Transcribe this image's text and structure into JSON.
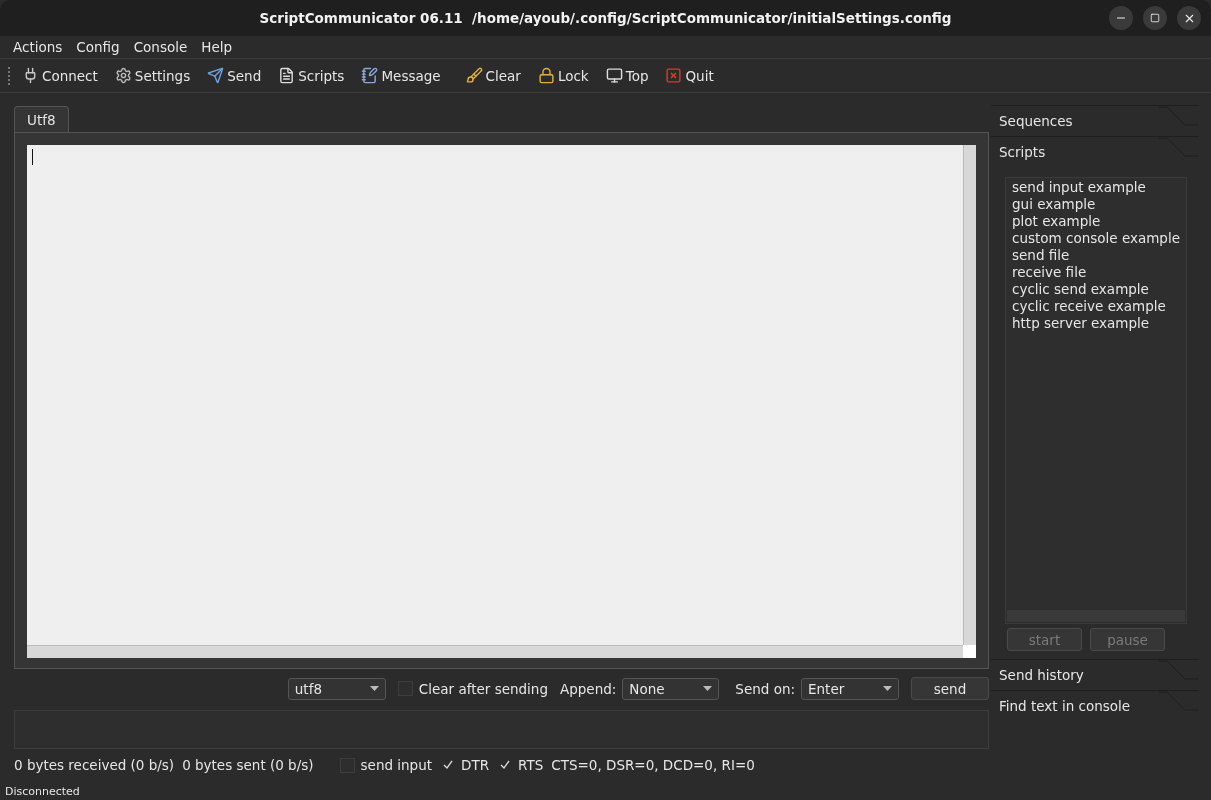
{
  "window": {
    "title": "ScriptCommunicator 06.11  /home/ayoub/.config/ScriptCommunicator/initialSettings.config"
  },
  "menu": [
    "Actions",
    "Config",
    "Console",
    "Help"
  ],
  "toolbar": [
    {
      "kind": "connect",
      "label": "Connect"
    },
    {
      "kind": "settings",
      "label": "Settings"
    },
    {
      "kind": "send",
      "label": "Send"
    },
    {
      "kind": "scripts",
      "label": "Scripts"
    },
    {
      "kind": "message",
      "label": "Message"
    },
    {
      "kind": "clear",
      "label": "Clear"
    },
    {
      "kind": "lock",
      "label": "Lock"
    },
    {
      "kind": "top",
      "label": "Top"
    },
    {
      "kind": "quit",
      "label": "Quit"
    }
  ],
  "console_tabs": [
    "Utf8"
  ],
  "send_bar": {
    "format": "utf8",
    "clear_after_sending": {
      "label": "Clear after sending",
      "checked": false
    },
    "append_label": "Append:",
    "append": "None",
    "send_on_label": "Send on:",
    "send_on": "Enter",
    "send_button": "send"
  },
  "status": {
    "received": "0 bytes received (0 b/s)",
    "sent": "0 bytes sent (0 b/s)",
    "checks": [
      {
        "label": "send input",
        "checked": false
      },
      {
        "label": "DTR",
        "checked": true
      },
      {
        "label": "RTS",
        "checked": true
      }
    ],
    "lines": "CTS=0, DSR=0, DCD=0, RI=0"
  },
  "dock": {
    "sections": [
      {
        "title": "Sequences"
      },
      {
        "title": "Scripts",
        "scripts": [
          "send input example",
          "gui example",
          "plot example",
          "custom console example",
          "send file",
          "receive file",
          "cyclic send example",
          "cyclic receive example",
          "http server example"
        ],
        "buttons": [
          {
            "label": "start",
            "disabled": true
          },
          {
            "label": "pause",
            "disabled": true
          }
        ]
      },
      {
        "title": "Send history"
      },
      {
        "title": "Find text in console"
      }
    ]
  },
  "status_bar": "Disconnected"
}
